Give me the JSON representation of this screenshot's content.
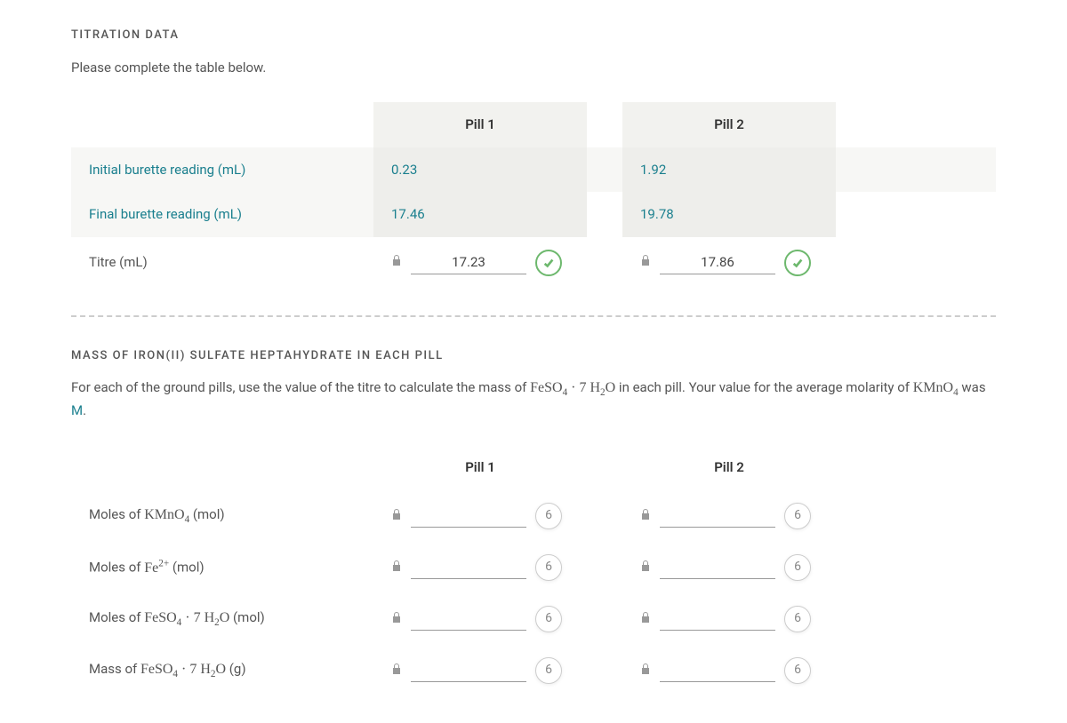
{
  "titration": {
    "heading": "TITRATION DATA",
    "instruction": "Please complete the table below.",
    "columns": [
      "Pill 1",
      "Pill 2"
    ],
    "rows": [
      {
        "label": "Initial burette reading (mL)",
        "values": [
          "0.23",
          "1.92"
        ],
        "editable": false,
        "link": true
      },
      {
        "label": "Final burette reading (mL)",
        "values": [
          "17.46",
          "19.78"
        ],
        "editable": false,
        "link": true
      },
      {
        "label": "Titre (mL)",
        "values": [
          "17.23",
          "17.86"
        ],
        "editable": true,
        "correct": true
      }
    ]
  },
  "mass_section": {
    "heading": "MASS OF IRON(II) SULFATE HEPTAHYDRATE IN EACH PILL",
    "instruction_prefix": "For each of the ground pills, use the value of the titre to calculate the mass of ",
    "instruction_formula1": "FeSO₄ · 7 H₂O",
    "instruction_mid": " in each pill. Your value for the average molarity of ",
    "instruction_formula2": "KMnO₄",
    "instruction_suffix1": " was ",
    "instruction_molarity": "M",
    "instruction_suffix2": ".",
    "columns": [
      "Pill 1",
      "Pill 2"
    ],
    "attempt_count": "6",
    "rows": [
      {
        "label_html": "Moles of <span class='formula'>KMnO<sub>4</sub></span> (mol)"
      },
      {
        "label_html": "Moles of <span class='formula'>Fe<sup>2+</sup></span> (mol)"
      },
      {
        "label_html": "Moles of <span class='formula'>FeSO<sub>4</sub> · 7 H<sub>2</sub>O</span> (mol)"
      },
      {
        "label_html": "Mass of <span class='formula'>FeSO<sub>4</sub> · 7 H<sub>2</sub>O</span> (g)"
      }
    ]
  }
}
